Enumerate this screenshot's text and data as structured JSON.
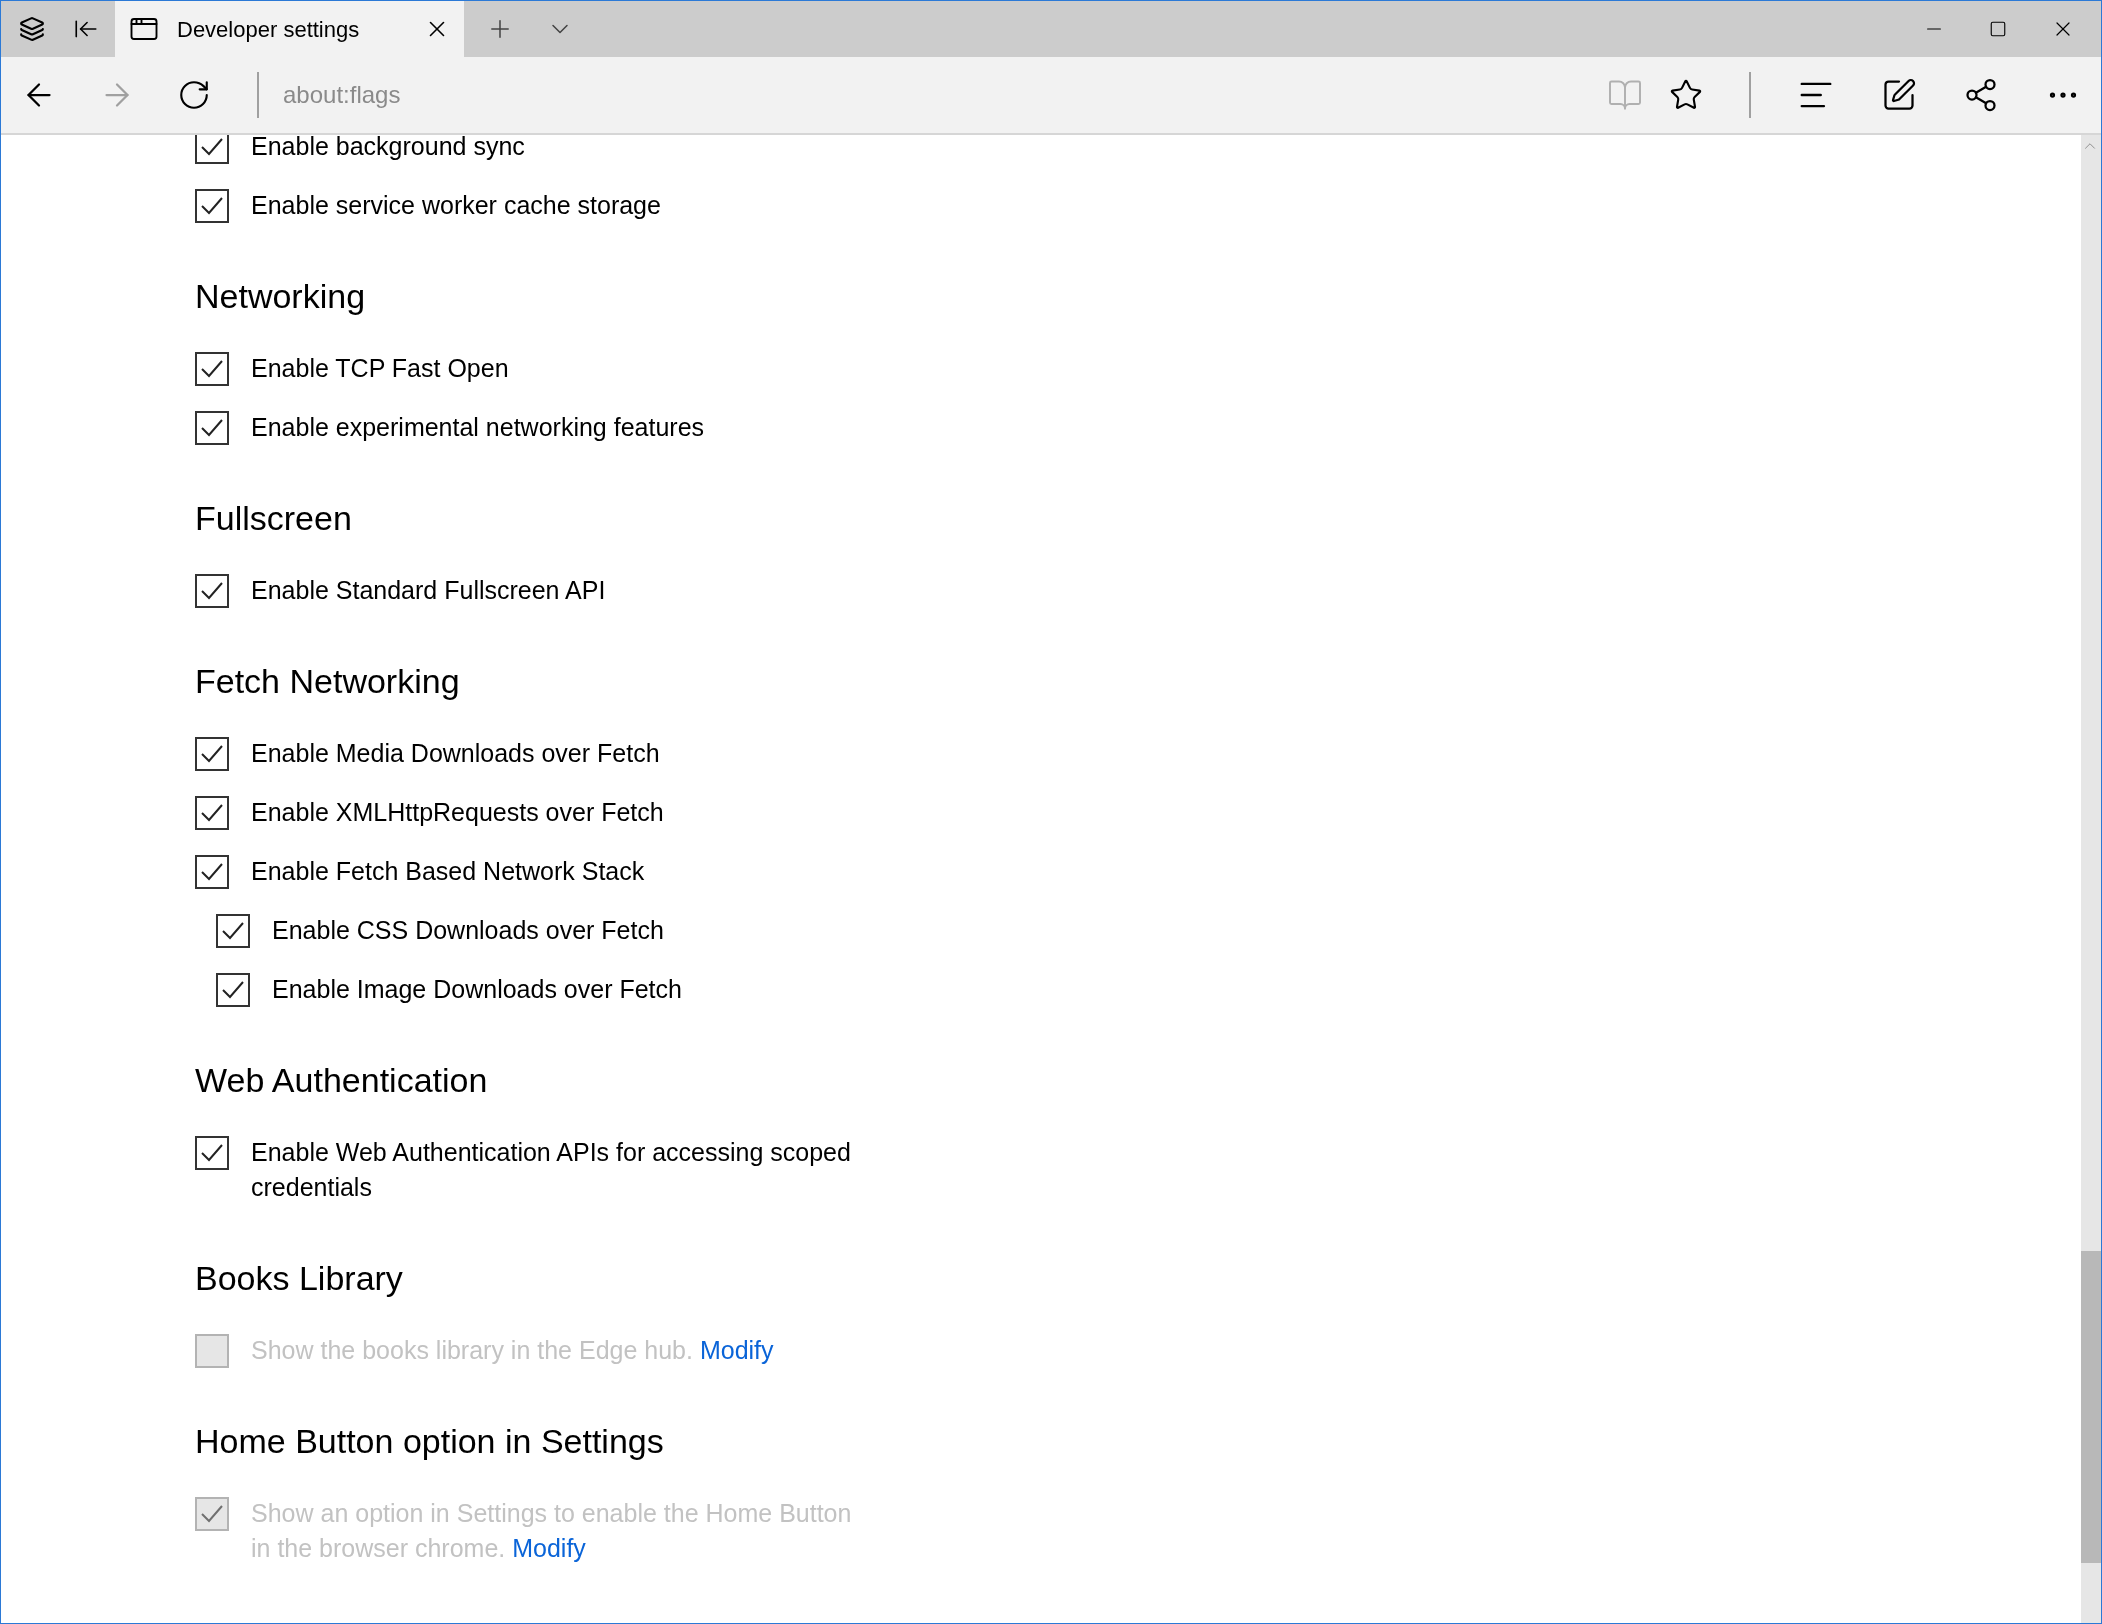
{
  "tabs": [
    {
      "title": "Developer settings",
      "selected": true
    }
  ],
  "address_bar": {
    "value": "about:flags"
  },
  "sections": [
    {
      "items": [
        {
          "label": "Enable background sync",
          "checked": true,
          "disabled": false
        },
        {
          "label": "Enable service worker cache storage",
          "checked": true,
          "disabled": false
        }
      ]
    },
    {
      "heading": "Networking",
      "items": [
        {
          "label": "Enable TCP Fast Open",
          "checked": true,
          "disabled": false
        },
        {
          "label": "Enable experimental networking features",
          "checked": true,
          "disabled": false
        }
      ]
    },
    {
      "heading": "Fullscreen",
      "items": [
        {
          "label": "Enable Standard Fullscreen API",
          "checked": true,
          "disabled": false
        }
      ]
    },
    {
      "heading": "Fetch Networking",
      "items": [
        {
          "label": "Enable Media Downloads over Fetch",
          "checked": true,
          "disabled": false
        },
        {
          "label": "Enable XMLHttpRequests over Fetch",
          "checked": true,
          "disabled": false
        },
        {
          "label": "Enable Fetch Based Network Stack",
          "checked": true,
          "disabled": false,
          "children": [
            {
              "label": "Enable CSS Downloads over Fetch",
              "checked": true,
              "disabled": false
            },
            {
              "label": "Enable Image Downloads over Fetch",
              "checked": true,
              "disabled": false
            }
          ]
        }
      ]
    },
    {
      "heading": "Web Authentication",
      "items": [
        {
          "label": "Enable Web Authentication APIs for accessing scoped credentials",
          "checked": true,
          "disabled": false
        }
      ]
    },
    {
      "heading": "Books Library",
      "items": [
        {
          "label": "Show the books library in the Edge hub.",
          "link": "Modify",
          "checked": false,
          "disabled": true
        }
      ]
    },
    {
      "heading": "Home Button option in Settings",
      "items": [
        {
          "label": "Show an option in Settings to enable the Home Button in the browser chrome.",
          "link": "Modify",
          "checked": true,
          "disabled": true
        }
      ]
    }
  ]
}
